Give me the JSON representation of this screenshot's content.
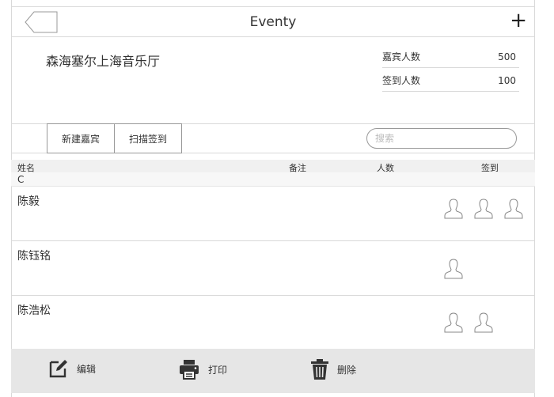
{
  "nav": {
    "title": "Eventy",
    "add_label": "+"
  },
  "venue": {
    "name": "森海塞尔上海音乐厅"
  },
  "stats": [
    {
      "label": "嘉宾人数",
      "value": "500"
    },
    {
      "label": "签到人数",
      "value": "100"
    }
  ],
  "toolbar": {
    "new_guest": "新建嘉宾",
    "scan_checkin": "扫描签到",
    "search_placeholder": "搜索"
  },
  "table": {
    "columns": [
      "姓名",
      "备注",
      "人数",
      "签到"
    ],
    "group_letter": "C",
    "rows": [
      {
        "name": "陈毅",
        "checked_in": 3
      },
      {
        "name": "陈钰铭",
        "checked_in": 1
      },
      {
        "name": "陈浩松",
        "checked_in": 2
      }
    ]
  },
  "actions": {
    "edit": "编辑",
    "print": "打印",
    "delete": "删除"
  }
}
